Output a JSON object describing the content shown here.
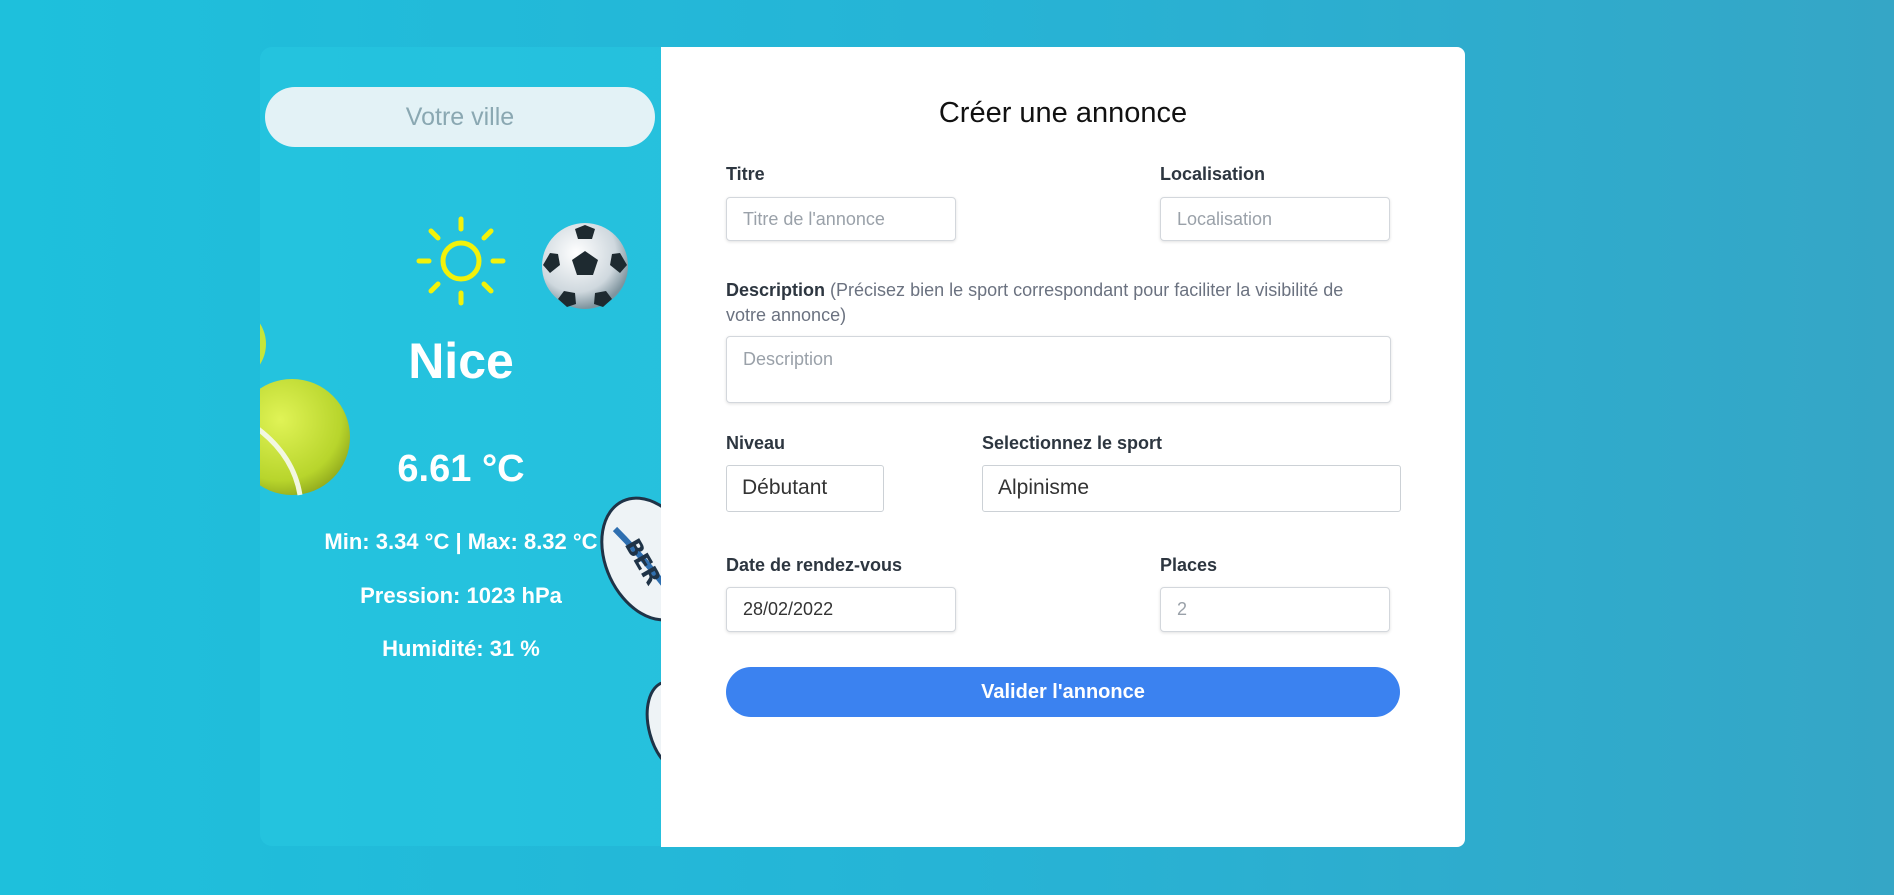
{
  "weather": {
    "city_placeholder": "Votre ville",
    "city": "Nice",
    "temperature": "6.61 °C",
    "min_max": "Min: 3.34 °C | Max: 8.32 °C",
    "pressure": "Pression: 1023 hPa",
    "humidity": "Humidité: 31 %",
    "icons": [
      "sun-icon",
      "soccer-ball-icon",
      "tennis-ball-icon",
      "rugby-ball-icon"
    ]
  },
  "form": {
    "title": "Créer une annonce",
    "titre_label": "Titre",
    "titre_placeholder": "Titre de l'annonce",
    "localisation_label": "Localisation",
    "localisation_placeholder": "Localisation",
    "description_label": "Description",
    "description_hint": "(Précisez bien le sport correspondant pour faciliter la visibilité de votre annonce)",
    "description_placeholder": "Description",
    "niveau_label": "Niveau",
    "niveau_value": "Débutant",
    "sport_label": "Selectionnez le sport",
    "sport_value": "Alpinisme",
    "date_label": "Date de rendez-vous",
    "date_value": "28/02/2022",
    "places_label": "Places",
    "places_placeholder": "2",
    "submit_label": "Valider l'annonce"
  },
  "colors": {
    "background": "#26b4d6",
    "button": "#3b82f0",
    "sun": "#f2f20a"
  }
}
